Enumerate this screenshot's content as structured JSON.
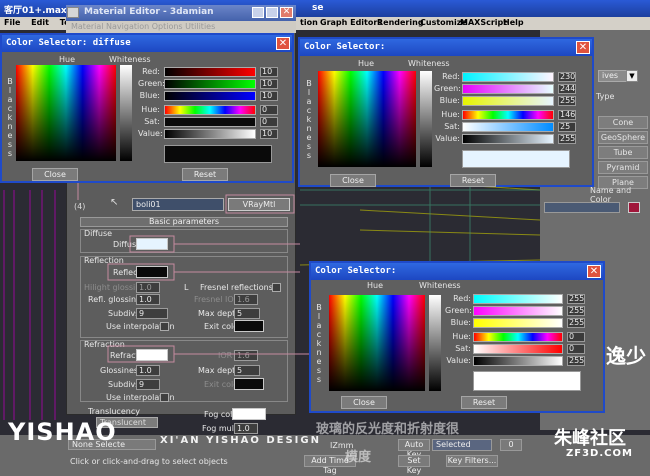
{
  "max_window": {
    "title": "客厅01+.max",
    "title_tail": "se",
    "menu": [
      "File",
      "Edit",
      "Tool",
      "tion",
      "Graph Editors",
      "Rendering",
      "Customize",
      "MAXScript",
      "Help"
    ]
  },
  "right_panel": {
    "dropdown": "ives",
    "type_label": "Type",
    "buttons": [
      "Cone",
      "GeoSphere",
      "Tube",
      "Pyramid",
      "Plane"
    ],
    "name_color_label": "Name and Color"
  },
  "material_editor": {
    "title": "Material Editor - 3damian",
    "menu": "Material  Navigation  Options  Utilities",
    "material_name": "boli01",
    "material_type": "VRayMtl",
    "slot_label": "(4)",
    "basic_params": "Basic parameters",
    "diffuse_section": "Diffuse",
    "diffuse_label": "Diffuse",
    "reflection_section": "Reflection",
    "reflect_label": "Reflect",
    "hilight_label": "Hilight glossiness",
    "hilight_value": "1.0",
    "l_label": "L",
    "fresnel_label": "Fresnel reflections",
    "refl_gloss_label": "Refl. glossiness",
    "refl_gloss_value": "1.0",
    "fresnel_ior_label": "Fresnel IOR",
    "fresnel_ior_value": "1.6",
    "subdivs_label": "Subdivs",
    "subdivs_value": "9",
    "max_depth_label": "Max depth",
    "max_depth_value": "5",
    "use_interp_label": "Use interpolation",
    "exit_color_label": "Exit color",
    "refraction_section": "Refraction",
    "refract_label": "Refract",
    "ior_label": "IOR",
    "ior_value": "1.6",
    "glossiness_label": "Glossiness",
    "glossiness_value": "1.0",
    "max_depth2_label": "Max depth",
    "max_depth2_value": "5",
    "subdivs2_label": "Subdivs",
    "subdivs2_value": "9",
    "exit_color2_label": "Exit color",
    "use_interp2_label": "Use interpolation",
    "translucency_label": "Translucency",
    "translucency_value": "Translucent",
    "fog_color_label": "Fog color",
    "fog_mult_label": "Fog multiplier",
    "fog_mult_value": "1.0"
  },
  "cs_diffuse": {
    "title": "Color Selector: diffuse",
    "hue_label": "Hue",
    "whiteness_label": "Whiteness",
    "blackness_letters": [
      "B",
      "l",
      "a",
      "c",
      "k",
      "n",
      "e",
      "s",
      "s"
    ],
    "rows": [
      {
        "label": "Red:",
        "value": "10"
      },
      {
        "label": "Green:",
        "value": "10"
      },
      {
        "label": "Blue:",
        "value": "10"
      },
      {
        "label": "Hue:",
        "value": "0"
      },
      {
        "label": "Sat:",
        "value": "0"
      },
      {
        "label": "Value:",
        "value": "10"
      }
    ],
    "close": "Close",
    "reset": "Reset",
    "preview_color": "#0a0a0a"
  },
  "cs_reflect": {
    "title": "Color Selector:",
    "hue_label": "Hue",
    "whiteness_label": "Whiteness",
    "blackness_letters": [
      "B",
      "l",
      "a",
      "c",
      "k",
      "n",
      "e",
      "s",
      "s"
    ],
    "rows": [
      {
        "label": "Red:",
        "value": "230"
      },
      {
        "label": "Green:",
        "value": "244"
      },
      {
        "label": "Blue:",
        "value": "255"
      },
      {
        "label": "Hue:",
        "value": "146"
      },
      {
        "label": "Sat:",
        "value": "25"
      },
      {
        "label": "Value:",
        "value": "255"
      }
    ],
    "close": "Close",
    "reset": "Reset",
    "preview_color": "#e6f4ff"
  },
  "cs_refract": {
    "title": "Color Selector:",
    "hue_label": "Hue",
    "whiteness_label": "Whiteness",
    "blackness_letters": [
      "B",
      "l",
      "a",
      "c",
      "k",
      "n",
      "e",
      "s",
      "s"
    ],
    "rows": [
      {
        "label": "Red:",
        "value": "255"
      },
      {
        "label": "Green:",
        "value": "255"
      },
      {
        "label": "Blue:",
        "value": "255"
      },
      {
        "label": "Hue:",
        "value": "0"
      },
      {
        "label": "Sat:",
        "value": "0"
      },
      {
        "label": "Value:",
        "value": "255"
      }
    ],
    "close": "Close",
    "reset": "Reset",
    "preview_color": "#ffffff"
  },
  "status_bar": {
    "none_select": "None Selecte",
    "hint": "Click or click-and-drag to select objects",
    "add_time_tag": "Add Time Tag",
    "auto_key": "Auto Key",
    "set_key": "Set Key",
    "selected": "Selected",
    "key_filters": "Key Filters...",
    "gizmo": "IZmm",
    "zero": "0"
  },
  "watermarks": {
    "yishao": "YISHAO",
    "tagline": "XI'AN YISHAO DESIGN",
    "caption": "玻璃的反光度和折射度很",
    "caption2": "模度",
    "site_cn": "朱峰社区",
    "site_en": "ZF3D.COM",
    "logo_char": "逸少"
  },
  "colors": {
    "dialog_blue": "#1f4ac9",
    "panel_grey": "#5d5d5d",
    "close_red": "#e0533e"
  }
}
